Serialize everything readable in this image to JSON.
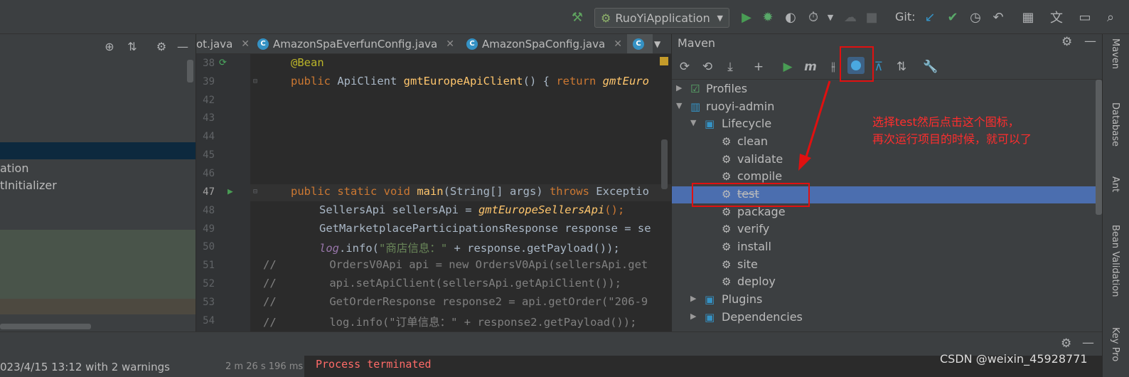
{
  "toolbar": {
    "run_config": "RuoYiApplication",
    "git_label": "Git:",
    "icons": [
      "hammer-icon",
      "run-icon",
      "debug-icon",
      "coverage-icon",
      "profile-icon",
      "stop-icon",
      "git-update-icon",
      "git-commit-icon",
      "history-icon",
      "rollback-icon",
      "project-structure-icon",
      "translate-icon",
      "terminal-icon"
    ]
  },
  "project": {
    "lines": [
      "ation",
      "tInitializer"
    ]
  },
  "tabs": [
    {
      "label": "ot.java"
    },
    {
      "label": "AmazonSpaEverfunConfig.java"
    },
    {
      "label": "AmazonSpaConfig.java"
    }
  ],
  "editor": {
    "line_numbers": [
      "38",
      "39",
      "42",
      "43",
      "44",
      "45",
      "46",
      "47",
      "48",
      "49",
      "50",
      "51",
      "52",
      "53",
      "54"
    ],
    "code": {
      "l38": "@Bean",
      "l39_kw": "public ",
      "l39_type": "ApiClient ",
      "l39_fn": "gmtEuropeApiClient",
      "l39_rest": "() { ",
      "l39_ret": "return ",
      "l39_tail": "gmtEuro",
      "l47_kw": "public static void ",
      "l47_fn": "main",
      "l47_args": "(String[] args) ",
      "l47_throws": "throws ",
      "l47_exc": "Exceptio",
      "l48_a": "SellersApi sellersApi = ",
      "l48_b": "gmtEuropeSellersApi",
      "l48_c": "();",
      "l49": "GetMarketplaceParticipationsResponse response = se",
      "l50_a": "log",
      "l50_b": ".info(",
      "l50_c": "\"商店信息：\"",
      "l50_d": " + response.getPayload());",
      "l51": "//        OrdersV0Api api = new OrdersV0Api(sellersApi.get",
      "l52": "//        api.setApiClient(sellersApi.getApiClient());",
      "l53": "//        GetOrderResponse response2 = api.getOrder(\"206-9",
      "l54": "//        log.info(\"订单信息：\" + response2.getPayload());"
    }
  },
  "maven": {
    "title": "Maven",
    "tree": {
      "profiles": "Profiles",
      "module": "ruoyi-admin",
      "lifecycle": "Lifecycle",
      "phases": [
        "clean",
        "validate",
        "compile",
        "test",
        "package",
        "verify",
        "install",
        "site",
        "deploy"
      ],
      "plugins": "Plugins",
      "dependencies": "Dependencies"
    },
    "annotation_line1": "选择test然后点击这个图标，",
    "annotation_line2": "再次运行项目的时候，就可以了",
    "selected_phase": "test"
  },
  "right_strip": [
    "Maven",
    "Database",
    "Ant",
    "Bean Validation",
    "Key Pro"
  ],
  "bottom": {
    "status_left": "023/4/15 13:12 with 2 warnings",
    "duration": "2 m 26 s 196 ms",
    "console_text": "Process terminated",
    "watermark": "CSDN @weixin_45928771"
  },
  "colors": {
    "accent_red": "#e01010",
    "selection_blue": "#4b6eaf"
  }
}
